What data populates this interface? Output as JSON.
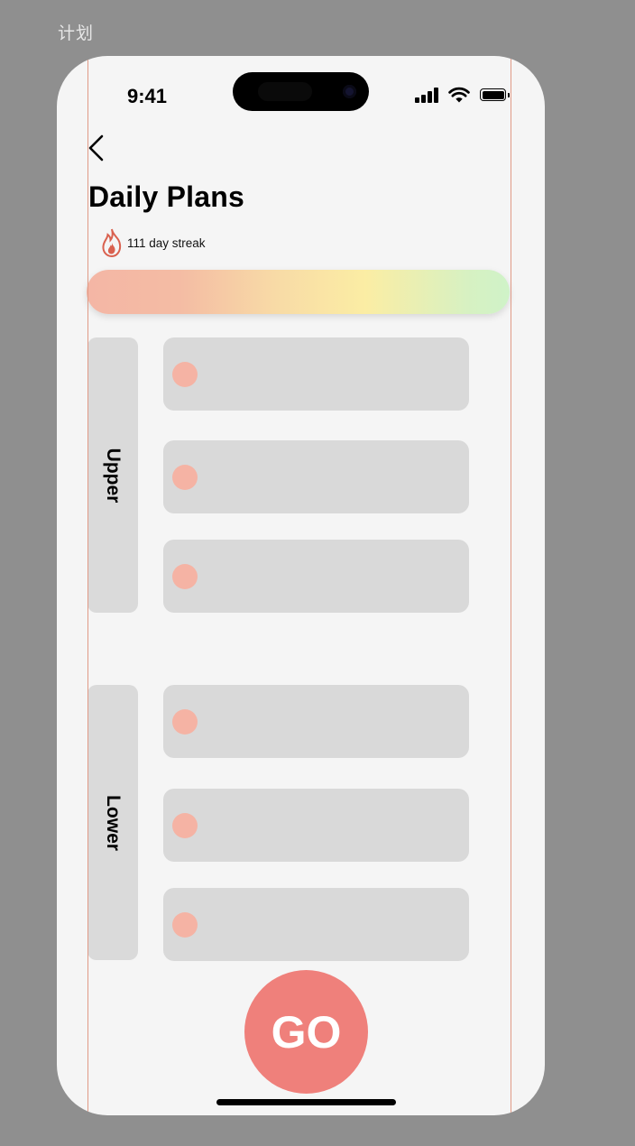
{
  "frame_label": "计划",
  "status_bar": {
    "time": "9:41"
  },
  "header": {
    "title": "Daily Plans",
    "streak_text": "111 day streak"
  },
  "sections": [
    {
      "label": "Upper",
      "items": [
        {
          "text": ""
        },
        {
          "text": ""
        },
        {
          "text": ""
        }
      ]
    },
    {
      "label": "Lower",
      "items": [
        {
          "text": ""
        },
        {
          "text": ""
        },
        {
          "text": ""
        }
      ]
    }
  ],
  "go_button": {
    "label": "GO"
  },
  "colors": {
    "accent": "#ef807b",
    "item_dot": "#f5b3a4",
    "card_bg": "#d9d9d9",
    "gradient_stops": [
      "#f4b6a5",
      "#fbeda4",
      "#cff3c8"
    ]
  },
  "icons": {
    "back": "chevron-left-icon",
    "streak": "flame-icon",
    "signal": "cellular-signal-icon",
    "wifi": "wifi-icon",
    "battery": "battery-icon"
  }
}
